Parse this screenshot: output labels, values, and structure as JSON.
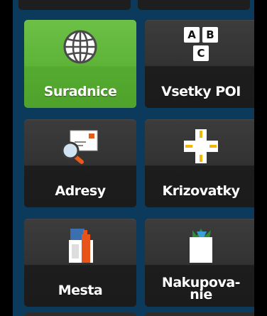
{
  "menu": {
    "items": [
      {
        "id": "suradnice",
        "label": "Suradnice",
        "icon": "globe-icon",
        "selected": true
      },
      {
        "id": "vsetky-poi",
        "label": "Vsetky POI",
        "icon": "abc-blocks-icon",
        "selected": false
      },
      {
        "id": "adresy",
        "label": "Adresy",
        "icon": "envelope-magnifier-icon",
        "selected": false
      },
      {
        "id": "krizovatky",
        "label": "Krizovatky",
        "icon": "crossroads-icon",
        "selected": false
      },
      {
        "id": "mesta",
        "label": "Mesta",
        "icon": "city-buildings-icon",
        "selected": false
      },
      {
        "id": "nakupovanie",
        "label_line1": "Nakupova-",
        "label_line2": "nie",
        "icon": "shopping-bag-icon",
        "selected": false
      }
    ],
    "blocks": {
      "a": "A",
      "b": "B",
      "c": "C"
    }
  },
  "colors": {
    "background": "#0b3a5c",
    "tile": "#333333",
    "tile_selected": "#5db437",
    "text": "#ffffff"
  }
}
